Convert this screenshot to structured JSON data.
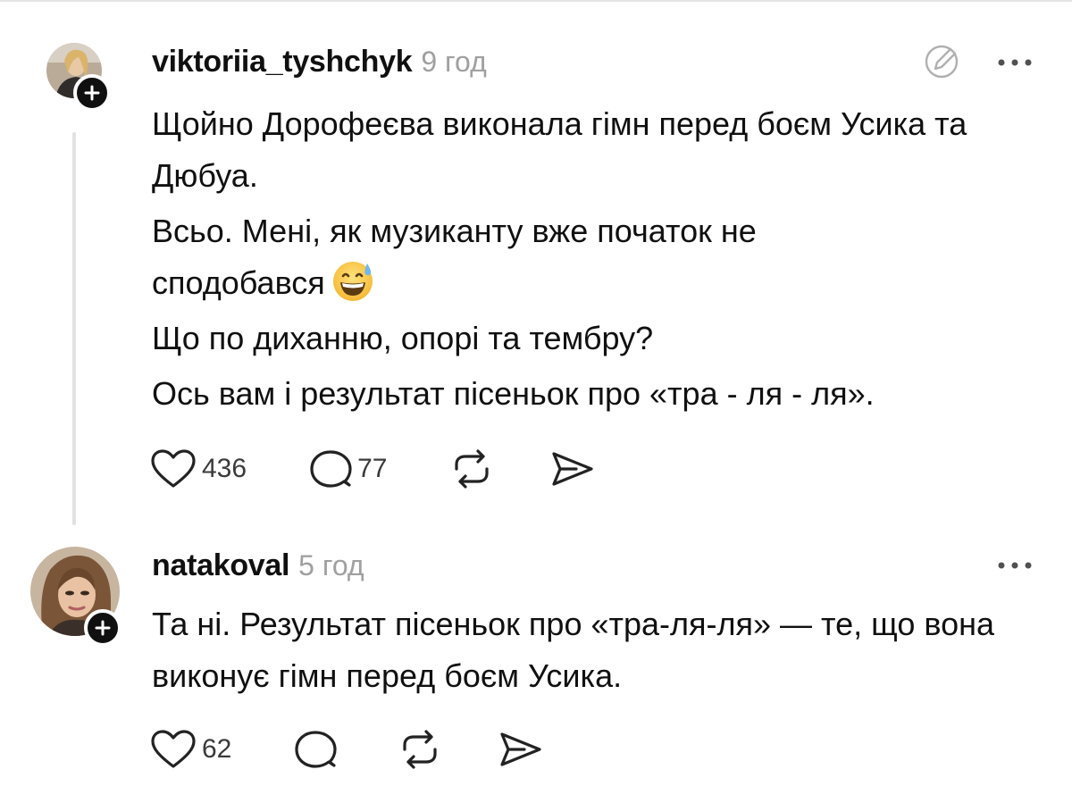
{
  "comments": [
    {
      "username": "viktoriia_tyshchyk",
      "time": "9 год",
      "lines": [
        "Щойно Дорофеєва виконала гімн перед боєм Усика та Дюбуа.",
        "Всьо. Мені, як музиканту вже початок не сподобався",
        "Що по диханню, опорі та тембру?",
        "Ось вам і результат пісеньок про «тра - ля - ля»."
      ],
      "emoji": "grinning-face-with-sweat",
      "likes": "436",
      "replies": "77",
      "icons": [
        "heart-icon",
        "comment-icon",
        "repost-icon",
        "share-icon",
        "edit-icon",
        "more-icon",
        "follow-plus-icon"
      ]
    },
    {
      "username": "natakoval",
      "time": "5 год",
      "lines": [
        "Та ні. Результат пісеньок про «тра-ля-ля» — те, що вона виконує гімн перед боєм Усика."
      ],
      "likes": "62",
      "icons": [
        "heart-icon",
        "comment-icon",
        "repost-icon",
        "share-icon",
        "more-icon",
        "follow-plus-icon"
      ]
    }
  ],
  "colors": {
    "text": "#101010",
    "muted": "#a0a0a0",
    "thread_line": "#e2e2e2",
    "badge": "#101010"
  }
}
